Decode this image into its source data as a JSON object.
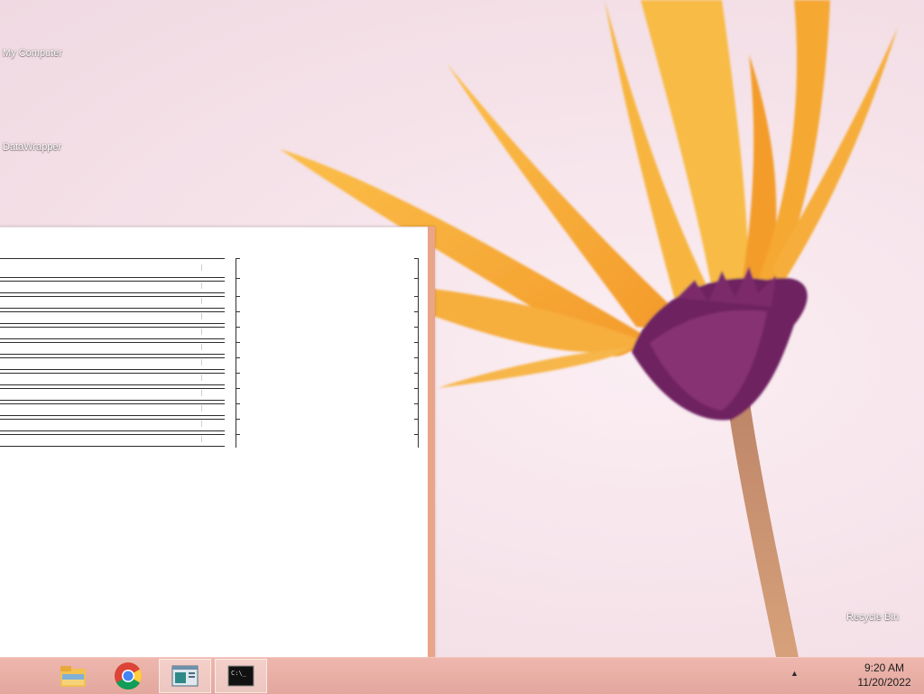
{
  "desktop": {
    "icons": [
      {
        "label": "My Computer"
      },
      {
        "label": "DataWrapper"
      },
      {
        "label": "Recycle Bin"
      }
    ]
  },
  "taskbar": {
    "buttons": [
      {
        "name": "File Explorer",
        "icon": "folder-icon",
        "active": false
      },
      {
        "name": "Google Chrome",
        "icon": "chrome-icon",
        "active": false
      },
      {
        "name": "Window",
        "icon": "window-app-icon",
        "active": true
      },
      {
        "name": "Command Prompt",
        "icon": "cmd-icon",
        "active": true
      }
    ],
    "clock": {
      "time": "9:20 AM",
      "date": "11/20/2022"
    },
    "cmd_text": "C:\\_"
  },
  "colors": {
    "taskbar": "#e2a79e",
    "window_border": "#eaa48a",
    "petal": "#f5a623",
    "flower_center": "#7b2a6b"
  }
}
